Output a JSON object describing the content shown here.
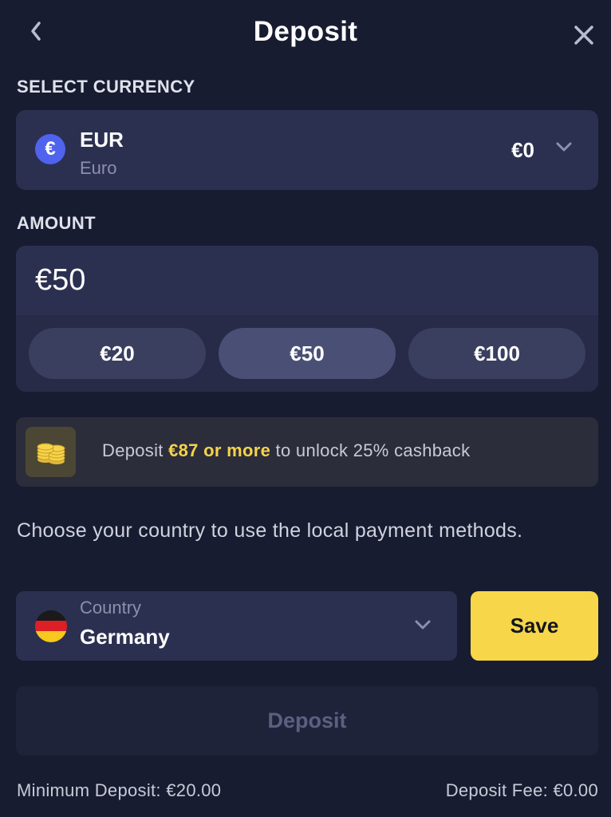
{
  "header": {
    "title": "Deposit",
    "back_icon": "chevron-left-icon",
    "close_icon": "close-icon"
  },
  "currency": {
    "section_label": "SELECT CURRENCY",
    "symbol": "€",
    "code": "EUR",
    "name": "Euro",
    "balance": "€0"
  },
  "amount": {
    "section_label": "AMOUNT",
    "value": "€50",
    "presets": [
      {
        "label": "€20",
        "selected": false
      },
      {
        "label": "€50",
        "selected": true
      },
      {
        "label": "€100",
        "selected": false
      }
    ]
  },
  "promo": {
    "prefix": "Deposit ",
    "highlight": "€87 or more",
    "suffix": " to unlock 25% cashback",
    "icon": "coins-icon"
  },
  "country": {
    "note": "Choose your country to use the local payment methods.",
    "label": "Country",
    "value": "Germany",
    "save_label": "Save"
  },
  "deposit_button": "Deposit",
  "footer": {
    "min_deposit": "Minimum Deposit: €20.00",
    "fee": "Deposit Fee: €0.00"
  },
  "colors": {
    "background": "#181c31",
    "panel": "#2c3050",
    "accent": "#f7d749",
    "currency_icon": "#4f63ef"
  }
}
